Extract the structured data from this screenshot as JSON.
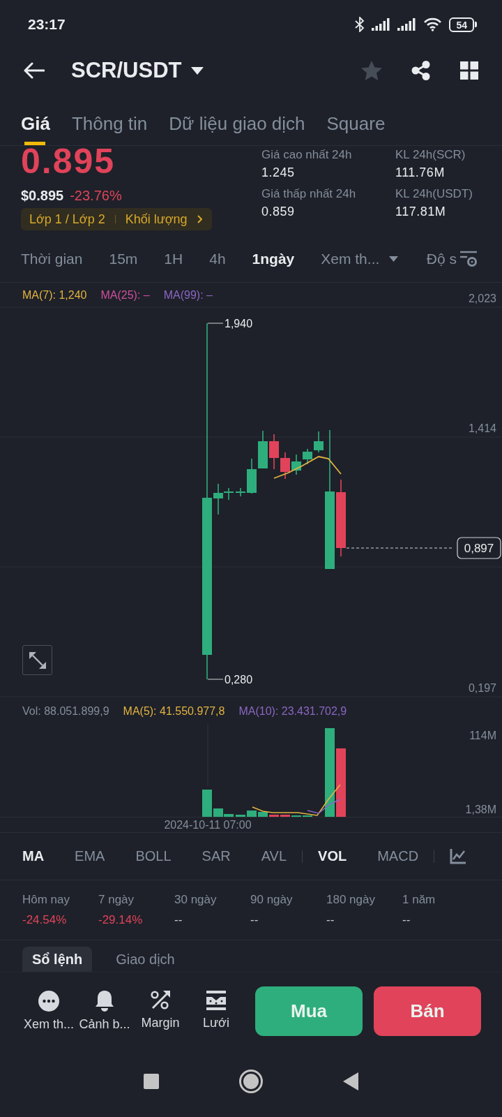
{
  "status_bar": {
    "time": "23:17",
    "battery": "54"
  },
  "header": {
    "pair": "SCR/USDT"
  },
  "tabs": [
    {
      "label": "Giá",
      "selected": true
    },
    {
      "label": "Thông tin",
      "selected": false
    },
    {
      "label": "Dữ liệu giao dịch",
      "selected": false
    },
    {
      "label": "Square",
      "selected": false
    }
  ],
  "price": {
    "last": "0.895",
    "negative": true,
    "usd": "$0.895",
    "change": "-23.76%",
    "tags": [
      "Lớp 1 / Lớp 2",
      "Khối lượng"
    ]
  },
  "stats": [
    {
      "label": "Giá cao nhất 24h",
      "value": "1.245"
    },
    {
      "label": "KL 24h(SCR)",
      "value": "111.76M"
    },
    {
      "label": "Giá thấp nhất 24h",
      "value": "0.859"
    },
    {
      "label": "KL 24h(USDT)",
      "value": "117.81M"
    }
  ],
  "chart_toolbar": {
    "intervals": [
      {
        "label": "Thời gian",
        "selected": false,
        "kind": "option"
      },
      {
        "label": "15m",
        "selected": false,
        "kind": "option"
      },
      {
        "label": "1H",
        "selected": false,
        "kind": "option"
      },
      {
        "label": "4h",
        "selected": false,
        "kind": "option"
      },
      {
        "label": "1ngày",
        "selected": true,
        "kind": "option"
      },
      {
        "label": "Xem th...",
        "selected": false,
        "kind": "dropdown"
      }
    ],
    "depth": "Độ s"
  },
  "chart": {
    "legend": [
      {
        "label": "MA(7): 1,240",
        "color": "#e3b341"
      },
      {
        "label": "MA(25): –",
        "color": "#cf4fa0"
      },
      {
        "label": "MA(99): –",
        "color": "#8b66c4"
      }
    ],
    "axis_labels": [
      "2,023",
      "1,414",
      "0,197"
    ],
    "high_marker": "1,940",
    "low_marker": "0,280",
    "last_price": "0,897"
  },
  "volume": {
    "legend": [
      {
        "label": "Vol: 88.051.899,9",
        "color": "#848e9c"
      },
      {
        "label": "MA(5): 41.550.977,8",
        "color": "#e3b341"
      },
      {
        "label": "MA(10): 23.431.702,9",
        "color": "#8b66c4"
      }
    ],
    "axis_labels": [
      "114M",
      "1,38M"
    ],
    "time_label": "2024-10-11 07:00"
  },
  "indicators": {
    "main": [
      {
        "label": "MA",
        "selected": true
      },
      {
        "label": "EMA",
        "selected": false
      },
      {
        "label": "BOLL",
        "selected": false
      },
      {
        "label": "SAR",
        "selected": false
      },
      {
        "label": "AVL",
        "selected": false
      }
    ],
    "sub": [
      {
        "label": "VOL",
        "selected": true
      },
      {
        "label": "MACD",
        "selected": false
      }
    ]
  },
  "performance": [
    {
      "period": "Hôm nay",
      "value": "-24.54%",
      "negative": true
    },
    {
      "period": "7 ngày",
      "value": "-29.14%",
      "negative": true
    },
    {
      "period": "30 ngày",
      "value": "--",
      "negative": false
    },
    {
      "period": "90 ngày",
      "value": "--",
      "negative": false
    },
    {
      "period": "180 ngày",
      "value": "--",
      "negative": false
    },
    {
      "period": "1 năm",
      "value": "--",
      "negative": false
    }
  ],
  "book_tabs": [
    {
      "label": "Sổ lệnh",
      "selected": true
    },
    {
      "label": "Giao dịch",
      "selected": false
    }
  ],
  "actions": [
    "Xem th...",
    "Cảnh b...",
    "Margin",
    "Lưới"
  ],
  "trade_buttons": [
    {
      "label": "Mua",
      "kind": "buy"
    },
    {
      "label": "Bán",
      "kind": "sell"
    }
  ]
}
